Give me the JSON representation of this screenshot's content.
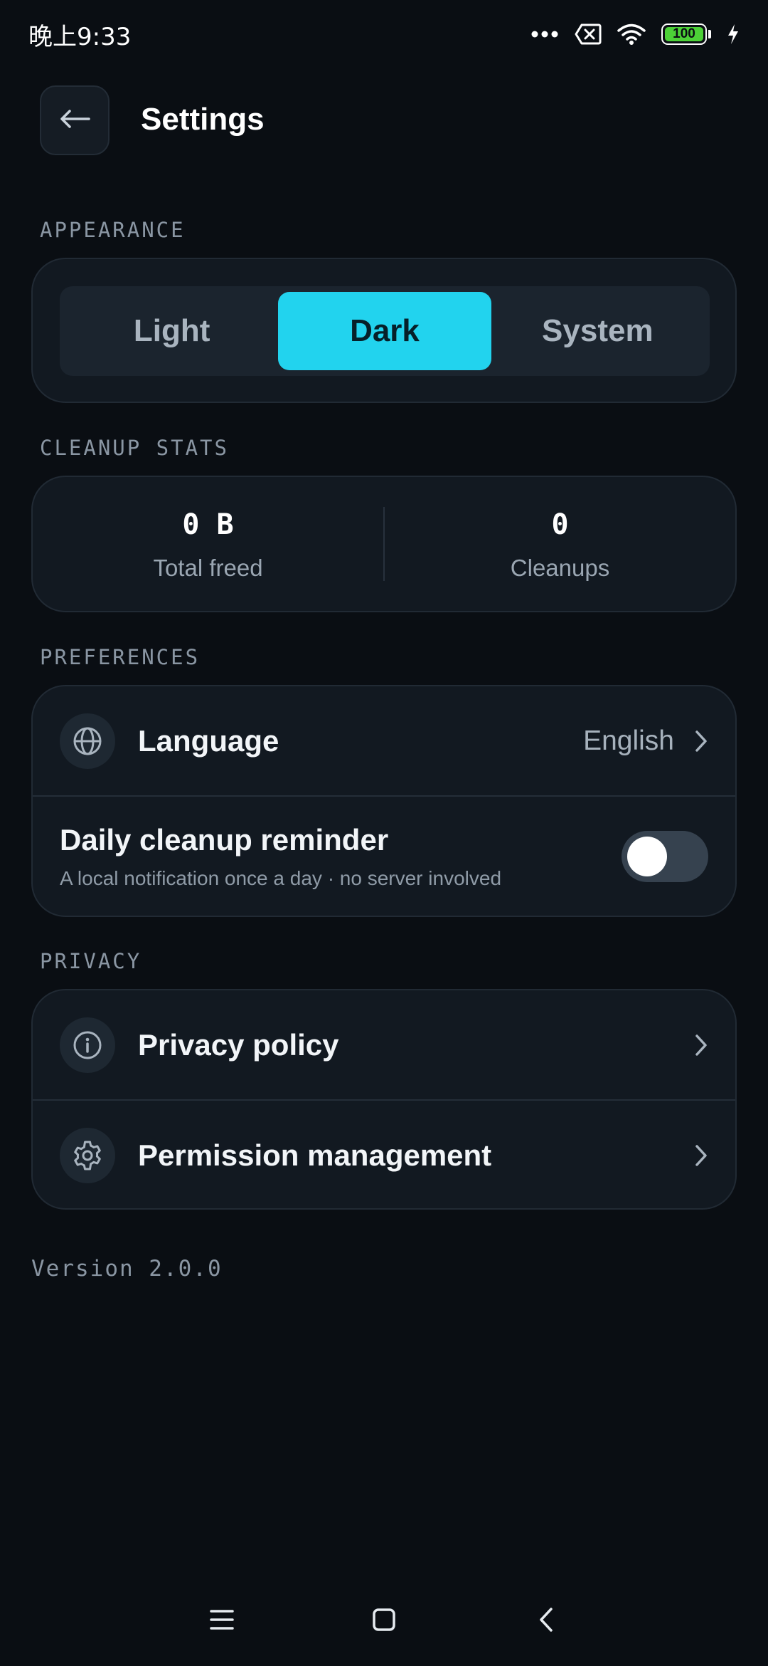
{
  "status_bar": {
    "time": "晚上9:33",
    "battery_level": "100",
    "icons": [
      "more-dots-icon",
      "sim-error-icon",
      "wifi-icon",
      "battery-icon",
      "charging-bolt-icon"
    ]
  },
  "header": {
    "title": "Settings",
    "back_icon": "arrow-left-icon"
  },
  "appearance": {
    "section_label": "APPEARANCE",
    "options": [
      "Light",
      "Dark",
      "System"
    ],
    "selected": "Dark"
  },
  "cleanup_stats": {
    "section_label": "CLEANUP STATS",
    "total_freed_value": "0 B",
    "total_freed_label": "Total freed",
    "cleanups_value": "0",
    "cleanups_label": "Cleanups"
  },
  "preferences": {
    "section_label": "PREFERENCES",
    "language_label": "Language",
    "language_value": "English",
    "reminder_title": "Daily cleanup reminder",
    "reminder_subtitle": "A local notification once a day · no server involved",
    "reminder_enabled": false
  },
  "privacy": {
    "section_label": "PRIVACY",
    "privacy_policy_label": "Privacy policy",
    "permission_label": "Permission management"
  },
  "version_text": "Version 2.0.0",
  "colors": {
    "background": "#0a0e13",
    "card": "#121921",
    "accent": "#22d3ee"
  },
  "nav_bar": {
    "icons": [
      "menu-icon",
      "home-icon",
      "back-icon"
    ]
  }
}
